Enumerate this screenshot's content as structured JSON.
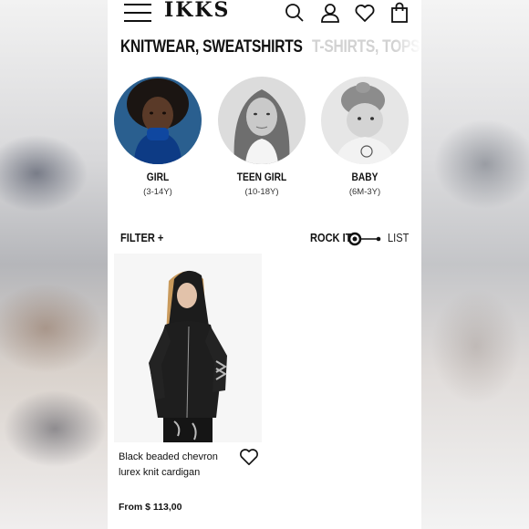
{
  "header": {
    "logo": "IKKS",
    "icons": [
      "menu-icon",
      "search-icon",
      "account-icon",
      "heart-icon",
      "bag-icon"
    ]
  },
  "categories": [
    {
      "label": "KNITWEAR, SWEATSHIRTS",
      "active": true
    },
    {
      "label": "T-SHIRTS, TOPS, B",
      "active": false
    }
  ],
  "age_groups": [
    {
      "label": "GIRL",
      "range": "(3-14Y)"
    },
    {
      "label": "TEEN GIRL",
      "range": "(10-18Y)"
    },
    {
      "label": "BABY",
      "range": "(6M-3Y)"
    }
  ],
  "toolbar": {
    "filter_label": "FILTER +",
    "rock_label": "ROCK IT!",
    "list_label": "LIST"
  },
  "products": [
    {
      "name": "Black beaded chevron lurex knit cardigan",
      "price_prefix": "From",
      "price": "$ 113,00"
    }
  ],
  "colors": {
    "text": "#111111",
    "inactive_tab": "#d2d2d2",
    "background": "#ffffff"
  }
}
